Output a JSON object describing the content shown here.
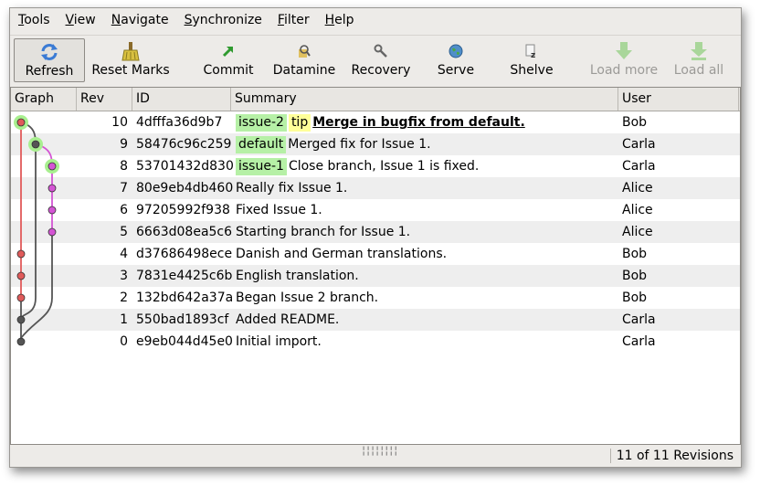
{
  "menu": [
    {
      "label": "Tools",
      "key": "T"
    },
    {
      "label": "View",
      "key": "V"
    },
    {
      "label": "Navigate",
      "key": "N"
    },
    {
      "label": "Synchronize",
      "key": "S"
    },
    {
      "label": "Filter",
      "key": "F"
    },
    {
      "label": "Help",
      "key": "H"
    }
  ],
  "toolbar": {
    "refresh": "Refresh",
    "reset_marks": "Reset Marks",
    "commit": "Commit",
    "datamine": "Datamine",
    "recovery": "Recovery",
    "serve": "Serve",
    "shelve": "Shelve",
    "load_more": "Load more",
    "load_all": "Load all"
  },
  "columns": {
    "graph": "Graph",
    "rev": "Rev",
    "id": "ID",
    "summary": "Summary",
    "user": "User"
  },
  "rows": [
    {
      "rev": "10",
      "id": "4dfffa36d9b7",
      "branch": "issue-2",
      "tag": "tip",
      "summary": "Merge in bugfix from default.",
      "user": "Bob",
      "bold": true
    },
    {
      "rev": "9",
      "id": "58476c96c259",
      "branch": "default",
      "tag": "",
      "summary": "Merged fix for Issue 1.",
      "user": "Carla",
      "bold": false
    },
    {
      "rev": "8",
      "id": "53701432d830",
      "branch": "issue-1",
      "tag": "",
      "summary": "Close branch, Issue 1 is fixed.",
      "user": "Carla",
      "bold": false
    },
    {
      "rev": "7",
      "id": "80e9eb4db460",
      "branch": "",
      "tag": "",
      "summary": "Really fix Issue 1.",
      "user": "Alice",
      "bold": false
    },
    {
      "rev": "6",
      "id": "97205992f938",
      "branch": "",
      "tag": "",
      "summary": "Fixed Issue 1.",
      "user": "Alice",
      "bold": false
    },
    {
      "rev": "5",
      "id": "6663d08ea5c6",
      "branch": "",
      "tag": "",
      "summary": "Starting branch for Issue 1.",
      "user": "Alice",
      "bold": false
    },
    {
      "rev": "4",
      "id": "d37686498ece",
      "branch": "",
      "tag": "",
      "summary": "Danish and German translations.",
      "user": "Bob",
      "bold": false
    },
    {
      "rev": "3",
      "id": "7831e4425c6b",
      "branch": "",
      "tag": "",
      "summary": "English translation.",
      "user": "Bob",
      "bold": false
    },
    {
      "rev": "2",
      "id": "132bd642a37a",
      "branch": "",
      "tag": "",
      "summary": "Began Issue 2 branch.",
      "user": "Bob",
      "bold": false
    },
    {
      "rev": "1",
      "id": "550bad1893cf",
      "branch": "",
      "tag": "",
      "summary": "Added README.",
      "user": "Carla",
      "bold": false
    },
    {
      "rev": "0",
      "id": "e9eb044d45e0",
      "branch": "",
      "tag": "",
      "summary": "Initial import.",
      "user": "Carla",
      "bold": false
    }
  ],
  "graph_colors": {
    "issue2": "#e05a5a",
    "default": "#555555",
    "issue1": "#d454d4",
    "highlight": "#a8ef8f"
  },
  "status": {
    "count": "11 of 11 Revisions"
  }
}
